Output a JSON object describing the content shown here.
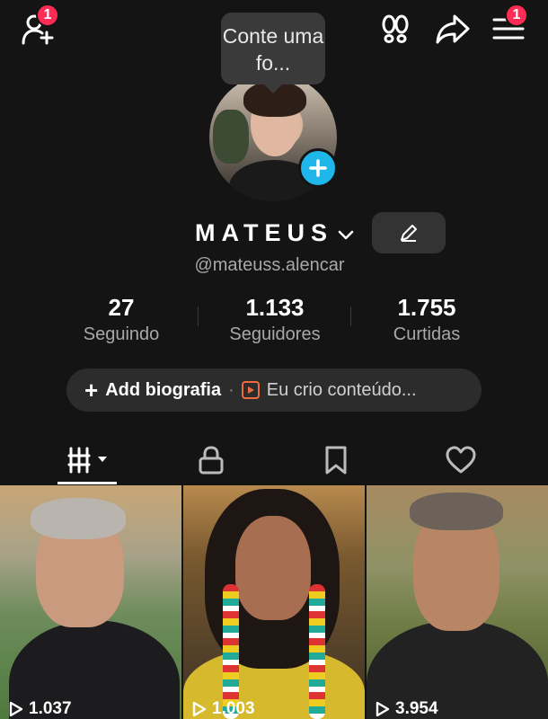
{
  "topbar": {
    "add_friends_badge": "1",
    "menu_badge": "1",
    "icons": [
      "add-friends-icon",
      "footprints-icon",
      "share-icon",
      "menu-icon"
    ]
  },
  "tooltip": {
    "text": "Conte uma fo..."
  },
  "profile": {
    "display_name": "MATEUS",
    "handle": "@mateuss.alencar"
  },
  "stats": [
    {
      "value": "27",
      "label": "Seguindo"
    },
    {
      "value": "1.133",
      "label": "Seguidores"
    },
    {
      "value": "1.755",
      "label": "Curtidas"
    }
  ],
  "bio": {
    "add_label": "Add biografia",
    "separator": "·",
    "category": "Eu crio conteúdo..."
  },
  "tabs": [
    "videos-grid-icon",
    "lock-icon",
    "bookmark-icon",
    "heart-icon"
  ],
  "videos": [
    {
      "views": "1.037"
    },
    {
      "views": "1.003"
    },
    {
      "views": "3.954"
    }
  ],
  "colors": {
    "background": "#141414",
    "badge": "#fe2c55",
    "add_photo": "#1fb7ea",
    "accent_play": "#f06b3c"
  }
}
